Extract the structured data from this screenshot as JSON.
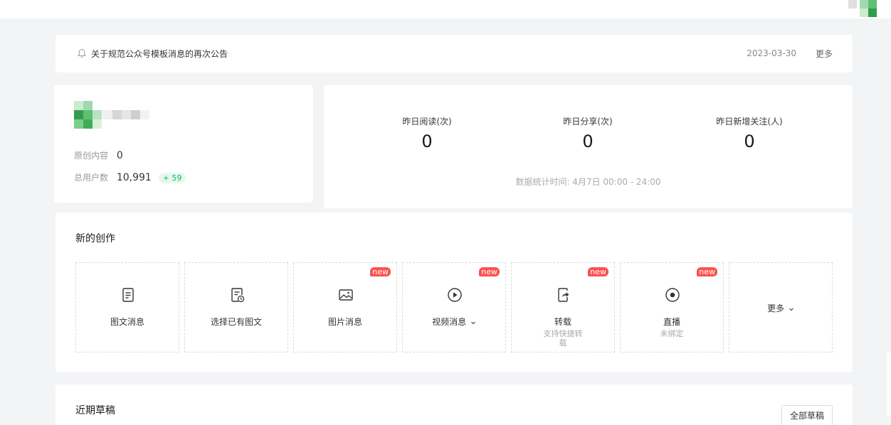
{
  "notice": {
    "text": "关于规范公众号模板消息的再次公告",
    "date": "2023-03-30",
    "more": "更多"
  },
  "account": {
    "original_label": "原创内容",
    "original_value": "0",
    "users_label": "总用户数",
    "users_value": "10,991",
    "users_delta": "+ 59"
  },
  "stats": {
    "items": [
      {
        "label": "昨日阅读(次)",
        "value": "0"
      },
      {
        "label": "昨日分享(次)",
        "value": "0"
      },
      {
        "label": "昨日新增关注(人)",
        "value": "0"
      }
    ],
    "time": "数据统计时间: 4月7日 00:00 - 24:00"
  },
  "create": {
    "title": "新的创作",
    "tiles": [
      {
        "label": "图文消息",
        "icon": "article-icon"
      },
      {
        "label": "选择已有图文",
        "icon": "article-history-icon"
      },
      {
        "label": "图片消息",
        "icon": "image-icon",
        "badge": "new"
      },
      {
        "label": "视频消息",
        "icon": "video-icon",
        "badge": "new"
      },
      {
        "label": "转载",
        "icon": "repost-icon",
        "badge": "new",
        "sub": "支持快捷转载"
      },
      {
        "label": "直播",
        "icon": "live-icon",
        "badge": "new",
        "sub": "未绑定"
      }
    ],
    "more": "更多"
  },
  "drafts": {
    "title": "近期草稿",
    "all_button": "全部草稿"
  },
  "colors": {
    "accent_green": "#07c160",
    "badge_red": "#fa5151",
    "background": "#f3f4f6"
  }
}
